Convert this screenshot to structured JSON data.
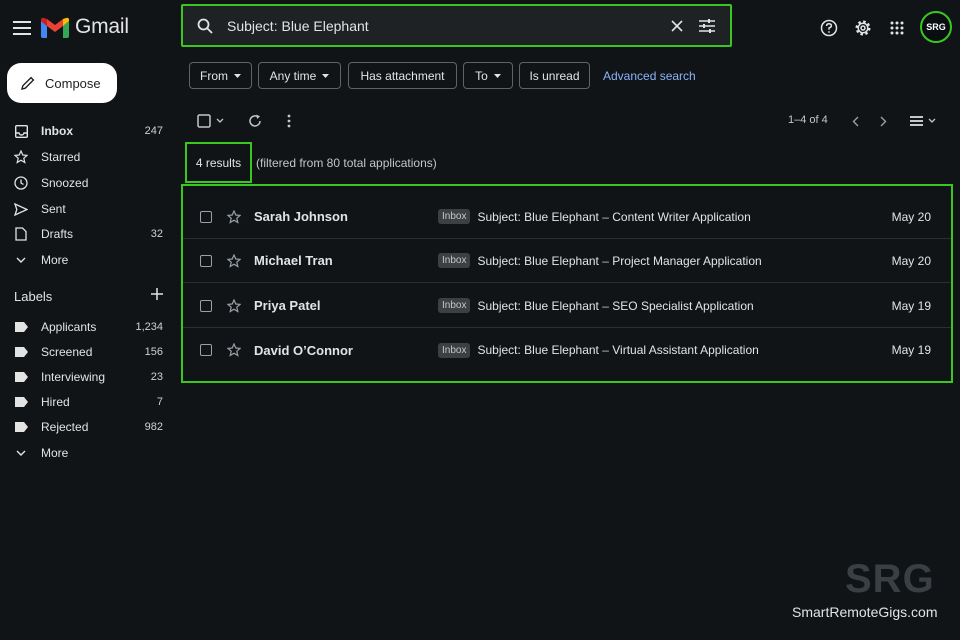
{
  "header": {
    "app_name": "Gmail",
    "search_value": "Subject: Blue Elephant",
    "avatar_initials": "SRG"
  },
  "compose_label": "Compose",
  "sidebar": {
    "items": [
      {
        "label": "Inbox",
        "count": "247",
        "icon": "inbox-icon"
      },
      {
        "label": "Starred",
        "count": "",
        "icon": "star-icon"
      },
      {
        "label": "Snoozed",
        "count": "",
        "icon": "clock-icon"
      },
      {
        "label": "Sent",
        "count": "",
        "icon": "send-icon"
      },
      {
        "label": "Drafts",
        "count": "32",
        "icon": "draft-icon"
      },
      {
        "label": "More",
        "count": "",
        "icon": "chevron-down-icon"
      }
    ],
    "labels_title": "Labels",
    "labels": [
      {
        "label": "Applicants",
        "count": "1,234"
      },
      {
        "label": "Screened",
        "count": "156"
      },
      {
        "label": "Interviewing",
        "count": "23"
      },
      {
        "label": "Hired",
        "count": "7"
      },
      {
        "label": "Rejected",
        "count": "982"
      }
    ],
    "labels_more": "More"
  },
  "filters": {
    "from": "From",
    "any_time": "Any time",
    "has_attachment": "Has attachment",
    "to": "To",
    "is_unread": "Is unread",
    "advanced_search": "Advanced search"
  },
  "toolbar": {
    "pager": "1–4 of 4"
  },
  "results": {
    "count_label": "4 results",
    "note": "(filtered from 80 total applications)"
  },
  "emails": [
    {
      "sender": "Sarah Johnson",
      "tag": "Inbox",
      "subject": "Subject: Blue Elephant",
      "sep": "–",
      "snippet": "Content Writer Application",
      "date": "May 20"
    },
    {
      "sender": "Michael Tran",
      "tag": "Inbox",
      "subject": "Subject: Blue Elephant",
      "sep": "–",
      "snippet": "Project Manager Application",
      "date": "May 20"
    },
    {
      "sender": "Priya Patel",
      "tag": "Inbox",
      "subject": "Subject: Blue Elephant",
      "sep": "–",
      "snippet": "SEO Specialist Application",
      "date": "May 19"
    },
    {
      "sender": "David O’Connor",
      "tag": "Inbox",
      "subject": "Subject: Blue Elephant",
      "sep": "–",
      "snippet": "Virtual Assistant Application",
      "date": "May 19"
    }
  ],
  "watermark": {
    "logo": "SRG",
    "site": "SmartRemoteGigs.com"
  },
  "colors": {
    "highlight": "#39c720",
    "background": "#111417",
    "link": "#8ab4f8"
  }
}
